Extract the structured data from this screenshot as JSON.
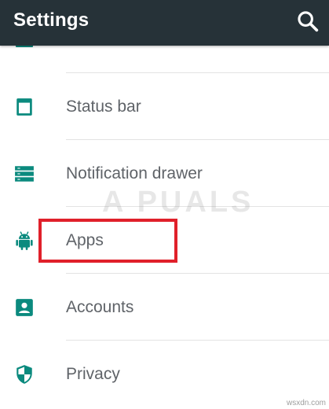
{
  "app_bar": {
    "title": "Settings",
    "background": "#263238",
    "action_icon": "search-icon"
  },
  "accent_color": "#0b8a7e",
  "settings": [
    {
      "label": "Status bar",
      "icon": "status-bar-icon"
    },
    {
      "label": "Notification drawer",
      "icon": "notification-drawer-icon"
    },
    {
      "label": "Apps",
      "icon": "android-icon",
      "highlighted": true
    },
    {
      "label": "Accounts",
      "icon": "account-box-icon"
    },
    {
      "label": "Privacy",
      "icon": "shield-icon"
    }
  ],
  "highlight_color": "#e0202a",
  "watermark": "A PUALS",
  "credit": "wsxdn.com"
}
